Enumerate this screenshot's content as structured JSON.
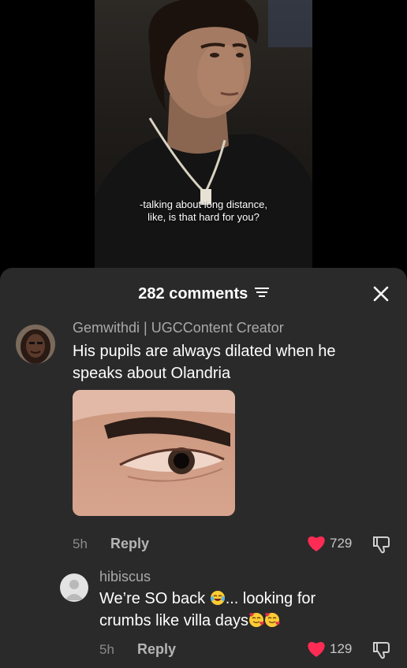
{
  "video": {
    "caption_line1": "-talking about long distance,",
    "caption_line2": "like, is that hard for you?"
  },
  "comments_panel": {
    "count_label": "282 comments",
    "icons": {
      "filter": "filter-lines-icon",
      "close": "close-x-icon"
    }
  },
  "comments": [
    {
      "username": "Gemwithdi | UGCContent Creator",
      "text_line1": "His pupils are always dilated when he",
      "text_line2": "speaks about Olandria",
      "time": "5h",
      "reply_label": "Reply",
      "likes": "729",
      "liked": true,
      "has_image": true
    },
    {
      "username": "hibiscus",
      "text_part1": "We’re SO back",
      "text_part2": "... looking for",
      "text_line2": "crumbs like villa days",
      "emojis": [
        "laughing-tears-emoji",
        "smiling-hearts-emoji",
        "smiling-hearts-emoji"
      ],
      "time": "5h",
      "reply_label": "Reply",
      "likes": "129",
      "liked": true
    }
  ],
  "colors": {
    "sheet_bg": "#2a2a2a",
    "like_red": "#fe2c55",
    "muted": "#8a8a8a"
  }
}
